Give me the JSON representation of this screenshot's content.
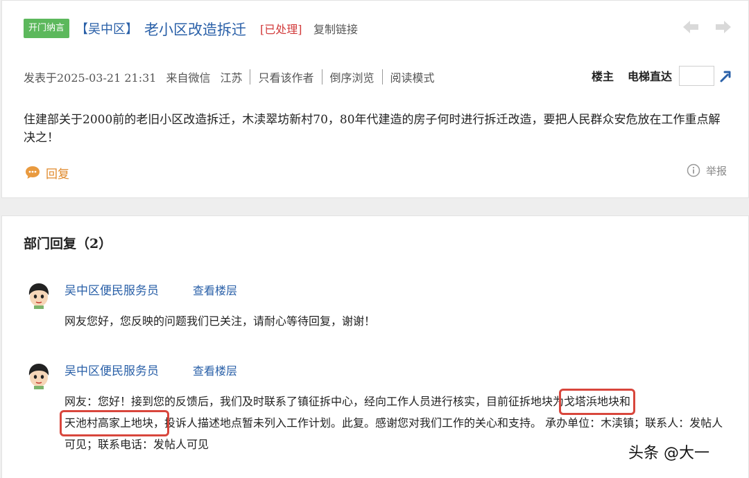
{
  "post": {
    "tag": "开门纳言",
    "district": "【吴中区】",
    "title": "老小区改造拆迁",
    "status": "[已处理]",
    "copy_link": "复制链接",
    "meta": {
      "posted": "发表于2025-03-21 21:31",
      "source": "来自微信",
      "location": "江苏",
      "only_author": "只看该作者",
      "reverse_order": "倒序浏览",
      "read_mode": "阅读模式"
    },
    "floor_owner": "楼主",
    "elevator": "电梯直达",
    "elevator_value": "",
    "body": "住建部关于2000前的老旧小区改造拆迁，木渎翠坊新村70，80年代建造的房子何时进行拆迁改造，要把人民群众安危放在工作重点解决之！",
    "reply_label": "回复",
    "report_label": "举报"
  },
  "replies_section": {
    "title": "部门回复（2）",
    "items": [
      {
        "name": "吴中区便民服务员",
        "view_floor": "查看楼层",
        "content": "网友您好，您反映的问题我们已关注，请耐心等待回复，谢谢！"
      },
      {
        "name": "吴中区便民服务员",
        "view_floor": "查看楼层",
        "content_before": "网友：您好！接到您的反馈后，我们及时联系了镇征拆中心，经向工作人员进行核实，目前征拆地块为",
        "highlight_1": "戈塔浜地块和",
        "highlight_2": "天池村高家上地块，",
        "content_after": "投诉人描述地点暂未列入工作计划。此复。感谢您对我们工作的关心和支持。 承办单位：木渎镇；联系人：发帖人可见；联系电话：发帖人可见"
      }
    ]
  },
  "watermark": "头条 @大一",
  "colors": {
    "link_blue": "#2a60a8",
    "tag_green": "#5cb85c",
    "status_red": "#d23b3b",
    "reply_orange": "#e08a2c",
    "highlight_red": "#d8463c"
  },
  "icons": [
    "prev-arrow-icon",
    "next-arrow-icon",
    "go-icon",
    "comment-icon",
    "info-icon",
    "avatar"
  ]
}
